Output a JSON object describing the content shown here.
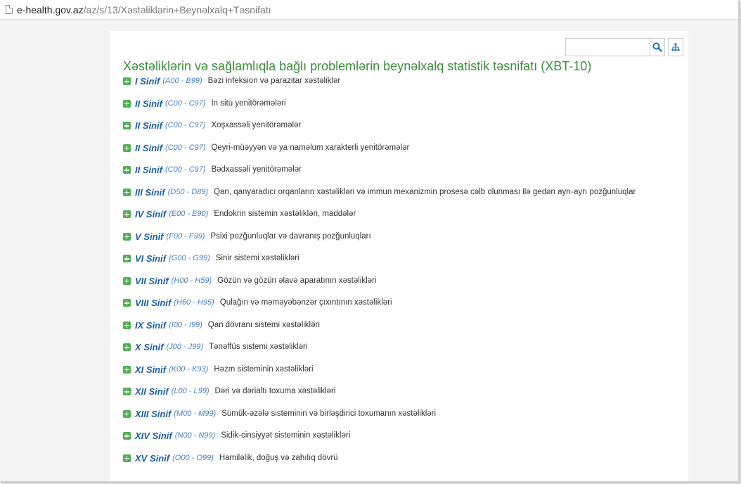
{
  "browser": {
    "url_host": "e-health.gov.az",
    "url_path": "/az/s/13/Xəstəliklərin+Beynəlxalq+Təsnifatı"
  },
  "search": {
    "value": "",
    "search_icon": "magnifier-icon",
    "tree_icon": "sitemap-icon"
  },
  "page": {
    "title": "Xəstəliklərin və sağlamlıqla bağlı problemlərin beynəlxalq statistik təsnifatı (XBT-10)"
  },
  "colors": {
    "title": "#3c8f3c",
    "expand_icon": "#4caf50",
    "class_name": "#1e5fa8",
    "class_range": "#4a7fc0"
  },
  "classes": [
    {
      "name": "I Sinif",
      "range": "(A00 - B99)",
      "desc": "Bəzi infeksion və parazitar xəstəliklər"
    },
    {
      "name": "II Sinif",
      "range": "(C00 - C97)",
      "desc": "In situ yenitörəmələri"
    },
    {
      "name": "II Sinif",
      "range": "(C00 - C97)",
      "desc": "Xoşxassəli yenitörəmələr"
    },
    {
      "name": "II Sinif",
      "range": "(C00 - C97)",
      "desc": "Qeyri-müəyyən və ya naməlum xarakterli yenitörəmələr"
    },
    {
      "name": "II Sinif",
      "range": "(C00 - C97)",
      "desc": "Bədxassəli yenitörəmələr"
    },
    {
      "name": "III Sinif",
      "range": "(D50 - D89)",
      "desc": "Qan, qanyaradıcı orqanların xəstəlikləri və immun mexanizmin prosesə cəlb olunması ilə gedən ayrı-ayrı pozğunluqlar"
    },
    {
      "name": "IV Sinif",
      "range": "(E00 - E90)",
      "desc": "Endokrin sistemin xəstəlikləri, maddələr"
    },
    {
      "name": "V Sinif",
      "range": "(F00 - F99)",
      "desc": "Psixi pozğunluqlar və davranış pozğunluqları"
    },
    {
      "name": "VI Sinif",
      "range": "(G00 - G99)",
      "desc": "Sinir sistemi xəstəlikləri"
    },
    {
      "name": "VII Sinif",
      "range": "(H00 - H59)",
      "desc": "Gözün və gözün əlavə aparatının xəstəlikləri"
    },
    {
      "name": "VIII Sinif",
      "range": "(H60 - H95)",
      "desc": "Qulağın və məməyəbənzər çıxıntının xəstəlikləri"
    },
    {
      "name": "IX Sinif",
      "range": "(I00 - I99)",
      "desc": "Qan dövranı sistemi xəstəlikləri"
    },
    {
      "name": "X Sinif",
      "range": "(J00 - J99)",
      "desc": "Tənəffüs sistemi xəstəlikləri"
    },
    {
      "name": "XI Sinif",
      "range": "(K00 - K93)",
      "desc": "Həzm sisteminin xəstəlikləri"
    },
    {
      "name": "XII Sinif",
      "range": "(L00 - L99)",
      "desc": "Dəri və dərialtı toxuma xəstəlikləri"
    },
    {
      "name": "XIII Sinif",
      "range": "(M00 - M99)",
      "desc": "Sümük-əzələ sisteminin və birləşdirici toxumanın xəstəlikləri"
    },
    {
      "name": "XIV Sinif",
      "range": "(N00 - N99)",
      "desc": "Sidik-cinsiyyət sisteminin xəstəlikləri"
    },
    {
      "name": "XV Sinif",
      "range": "(O00 - O99)",
      "desc": "Hamiləlik, doğuş və zahılıq dövrü"
    }
  ]
}
